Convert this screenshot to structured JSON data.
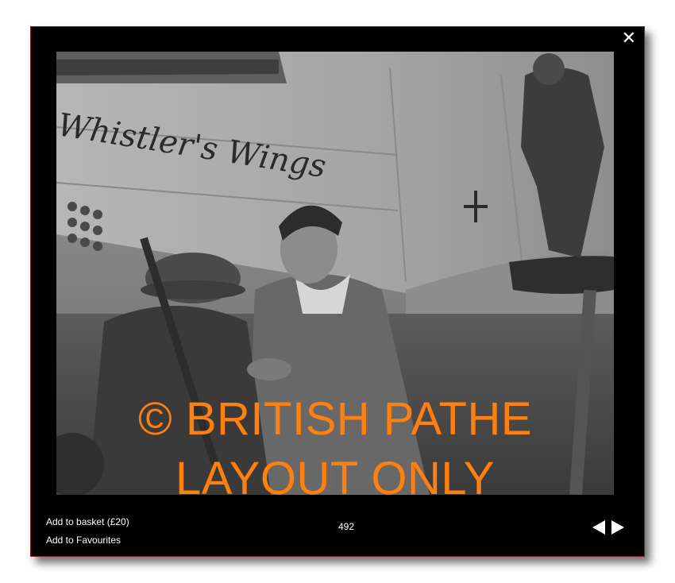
{
  "lightbox": {
    "close_label": "✕",
    "watermark_line1": "© BRITISH PATHE",
    "watermark_line2": "LAYOUT ONLY",
    "aircraft_nose_art": "Whistler's Wings",
    "add_to_basket": "Add to basket (£20)",
    "add_to_favourites": "Add to Favourites",
    "counter": "492",
    "prev_icon": "triangle-left-icon",
    "next_icon": "triangle-right-icon"
  },
  "colors": {
    "watermark": "#ff7f0f",
    "frame_border": "#7a1e1e",
    "panel_background": "#000000"
  }
}
